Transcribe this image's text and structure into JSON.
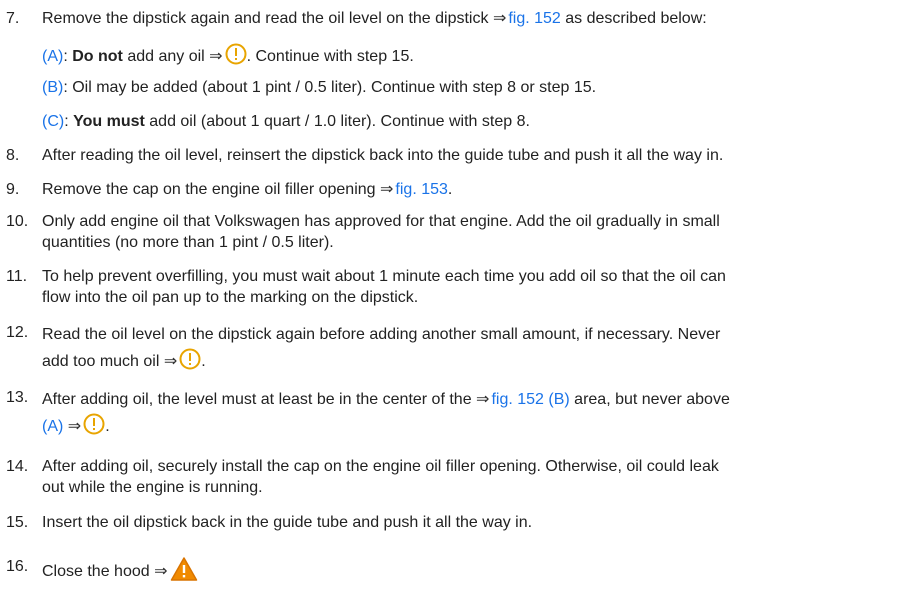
{
  "colors": {
    "link": "#1a73e8",
    "notice_icon": "#e8a400",
    "warning_icon": "#f08a00"
  },
  "icons": {
    "notice": "notice-circle-icon",
    "warning": "warning-triangle-icon"
  },
  "arrow": "⇒",
  "steps": {
    "s7": {
      "num": "7.",
      "text": "Remove the dipstick again and read the oil level on the dipstick",
      "fig": "fig. 152",
      "tail": "as described below:"
    },
    "subA": {
      "label": "(A)",
      "bold": "Do not",
      "text1": "add any oil",
      "text2": ". Continue with step 15."
    },
    "subB": {
      "label": "(B)",
      "text": ": Oil may be added (about 1 pint / 0.5 liter). Continue with step 8 or step 15."
    },
    "subC": {
      "label": "(C)",
      "bold": "You must",
      "text": "add oil (about 1 quart / 1.0 liter). Continue with step 8."
    },
    "s8": {
      "num": "8.",
      "text": "After reading the oil level, reinsert the dipstick back into the guide tube and push it all the way in."
    },
    "s9": {
      "num": "9.",
      "text": "Remove the cap on the engine oil filler opening",
      "fig": "fig. 153",
      "tail": "."
    },
    "s10": {
      "num": "10.",
      "line1": "Only add engine oil that Volkswagen has approved for that engine. Add the oil gradually in small",
      "line2": "quantities (no more than 1 pint / 0.5 liter)."
    },
    "s11": {
      "num": "11.",
      "line1": "To help prevent overfilling, you must wait about 1 minute each time you add oil so that the oil can",
      "line2": "flow into the oil pan up to the marking on the dipstick."
    },
    "s12": {
      "num": "12.",
      "line1": "Read the oil level on the dipstick again before adding another small amount, if necessary. Never",
      "line2": "add too much oil",
      "tail": "."
    },
    "s13": {
      "num": "13.",
      "text": "After adding oil, the level must at least be in the center of the",
      "fig": "fig. 152 (B)",
      "mid": "area, but never above",
      "ref": "(A)",
      "tail": "."
    },
    "s14": {
      "num": "14.",
      "line1": "After adding oil, securely install the cap on the engine oil filler opening. Otherwise, oil could leak",
      "line2": "out while the engine is running."
    },
    "s15": {
      "num": "15.",
      "text": "Insert the oil dipstick back in the guide tube and push it all the way in."
    },
    "s16": {
      "num": "16.",
      "text": "Close the hood"
    }
  }
}
